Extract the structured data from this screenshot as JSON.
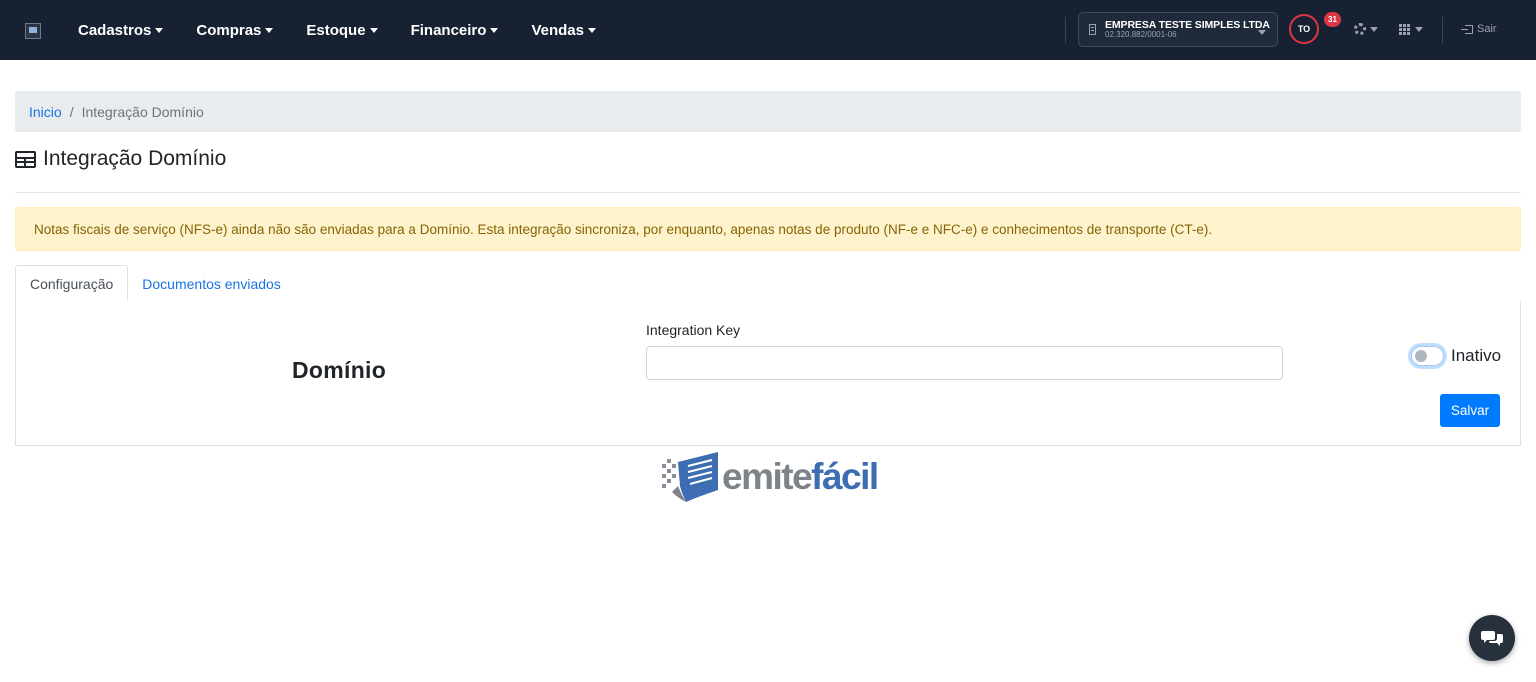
{
  "nav": {
    "menu": [
      {
        "label": "Cadastros"
      },
      {
        "label": "Compras"
      },
      {
        "label": "Estoque"
      },
      {
        "label": "Financeiro"
      },
      {
        "label": "Vendas"
      }
    ],
    "company": {
      "name": "EMPRESA TESTE SIMPLES LTDA",
      "cnpj": "02.320.882/0001-06"
    },
    "user": {
      "initials": "TO",
      "notifications": "31"
    },
    "exit_label": "Sair"
  },
  "breadcrumb": {
    "home": "Inicio",
    "separator": "/",
    "current": "Integração Domínio"
  },
  "page": {
    "title": "Integração Domínio"
  },
  "alert": {
    "text": "Notas fiscais de serviço (NFS-e) ainda não são enviadas para a Domínio. Esta integração sincroniza, por enquanto, apenas notas de produto (NF-e e NFC-e) e conhecimentos de transporte (CT-e)."
  },
  "tabs": [
    {
      "label": "Configuração",
      "active": true
    },
    {
      "label": "Documentos enviados",
      "active": false
    }
  ],
  "integration": {
    "name": "Domínio",
    "key_label": "Integration Key",
    "key_value": "",
    "status_label": "Inativo",
    "enabled": false,
    "save_label": "Salvar"
  },
  "footer_logo": {
    "part1": "emite",
    "part2": "fácil"
  },
  "colors": {
    "navbar": "#182131",
    "primary": "#007bff",
    "link": "#1a73e8",
    "alert_bg": "#fff3cd",
    "alert_text": "#856404",
    "badge": "#dc3545"
  }
}
